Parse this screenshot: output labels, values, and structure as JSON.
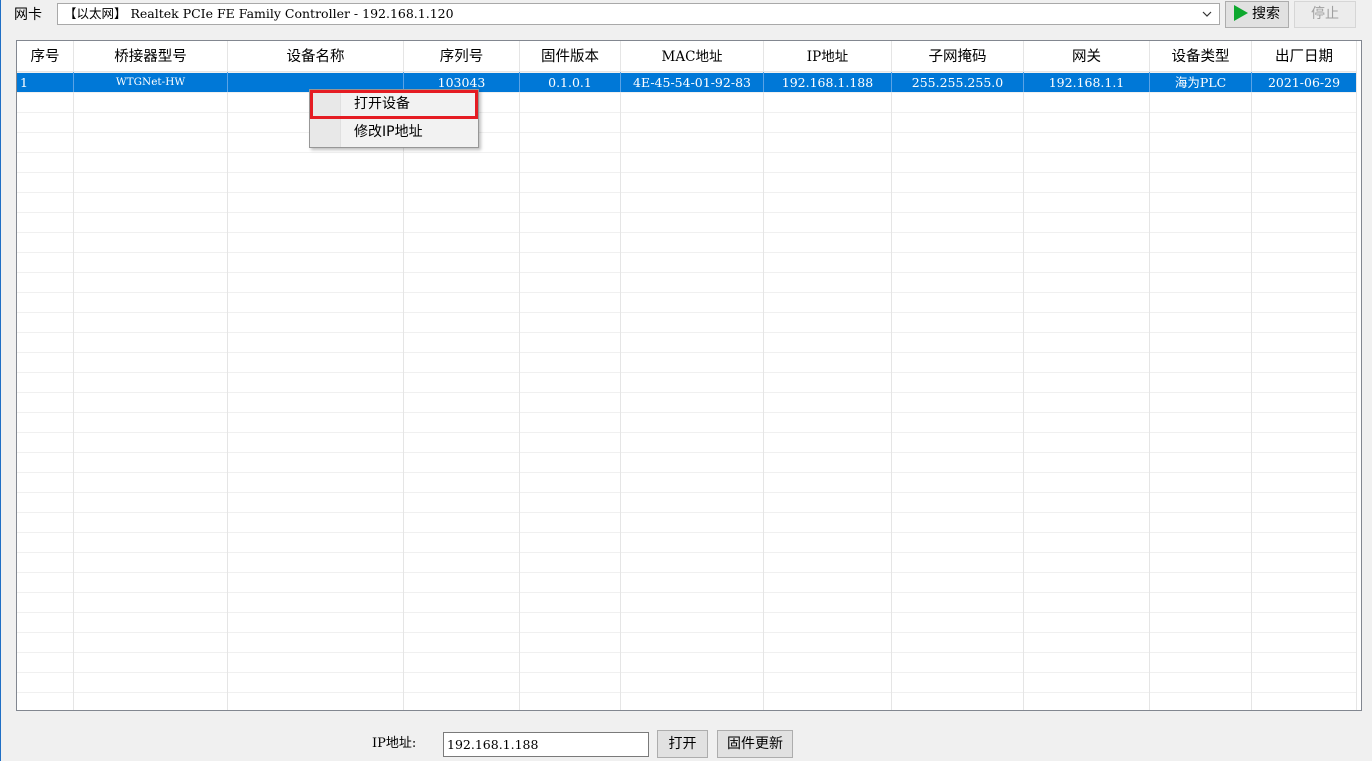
{
  "toolbar": {
    "nic_label": "网卡",
    "nic_value": "【以太网】 Realtek PCIe FE Family Controller - 192.168.1.120",
    "search_label": "搜索",
    "stop_label": "停止"
  },
  "table": {
    "columns": [
      "序号",
      "桥接器型号",
      "设备名称",
      "序列号",
      "固件版本",
      "MAC地址",
      "IP地址",
      "子网掩码",
      "网关",
      "设备类型",
      "出厂日期"
    ],
    "rows": [
      [
        "1",
        "WTGNet-HW",
        "",
        "103043",
        "0.1.0.1",
        "4E-45-54-01-92-83",
        "192.168.1.188",
        "255.255.255.0",
        "192.168.1.1",
        "海为PLC",
        "2021-06-29"
      ]
    ],
    "selected_row": 0
  },
  "context_menu": {
    "items": [
      "打开设备",
      "修改IP地址"
    ]
  },
  "bottom": {
    "ip_label": "IP地址:",
    "ip_value": "192.168.1.188",
    "open_label": "打开",
    "firmware_label": "固件更新"
  },
  "colors": {
    "selection": "#0078d7",
    "highlight_border": "#e51c23",
    "play_icon": "#0da82e"
  }
}
